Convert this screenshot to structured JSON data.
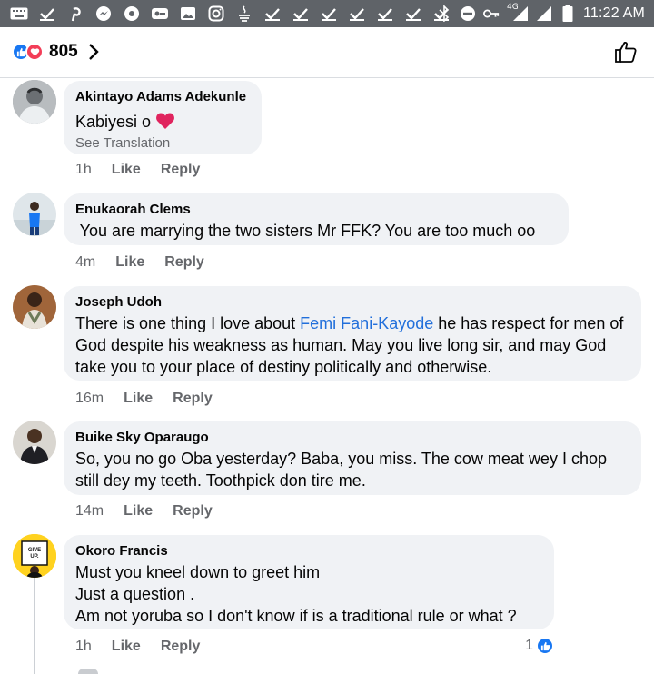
{
  "status_bar": {
    "time": "11:22 AM",
    "network": "4G",
    "left_icons": [
      "keyboard-icon",
      "check-icon",
      "pinterest-icon",
      "messenger-icon",
      "dot-icon",
      "vpn-icon",
      "image-icon",
      "instagram-icon",
      "java-icon",
      "check-icon",
      "check-icon",
      "check-icon",
      "check-icon",
      "check-icon",
      "check-icon",
      "check-icon"
    ],
    "right_icons": [
      "bluetooth-icon",
      "do-not-disturb-icon",
      "key-icon",
      "signal-icon",
      "signal-icon",
      "battery-icon"
    ]
  },
  "header": {
    "reaction_count": "805",
    "reactions": [
      "like",
      "love"
    ]
  },
  "colors": {
    "accent": "#1877f2",
    "love": "#f33e58",
    "bubble": "#f0f2f5",
    "muted": "#65676b",
    "mention": "#216fdb"
  },
  "comments": [
    {
      "author": "Akintayo Adams Adekunle",
      "text": "Kabiyesi o",
      "emoji": "heart",
      "see_translation": "See Translation",
      "time": "1h",
      "like": "Like",
      "reply": "Reply"
    },
    {
      "author": "Enukaorah Clems",
      "text": " You are marrying the two sisters Mr FFK? You are too much oo",
      "time": "4m",
      "like": "Like",
      "reply": "Reply"
    },
    {
      "author": "Joseph Udoh",
      "text_before": "There is one thing I love about ",
      "mention": "Femi Fani-Kayode",
      "text_after": " he has respect for men of God despite his weakness as human. May you live long sir, and may God take you to your place of destiny politically and otherwise.",
      "time": "16m",
      "like": "Like",
      "reply": "Reply"
    },
    {
      "author": "Buike Sky Oparaugo",
      "text": "So, you no go Oba yesterday? Baba, you miss. The cow meat wey I chop still dey my teeth. Toothpick don tire me.",
      "time": "14m",
      "like": "Like",
      "reply": "Reply"
    },
    {
      "author": "Okoro Francis",
      "lines": [
        "Must you kneel down to greet him",
        "Just a question .",
        "Am not yoruba so I don't know if is a traditional rule or what ?"
      ],
      "time": "1h",
      "like": "Like",
      "reply": "Reply",
      "reaction_count": "1",
      "avatar_text": "GIVE UP."
    }
  ]
}
